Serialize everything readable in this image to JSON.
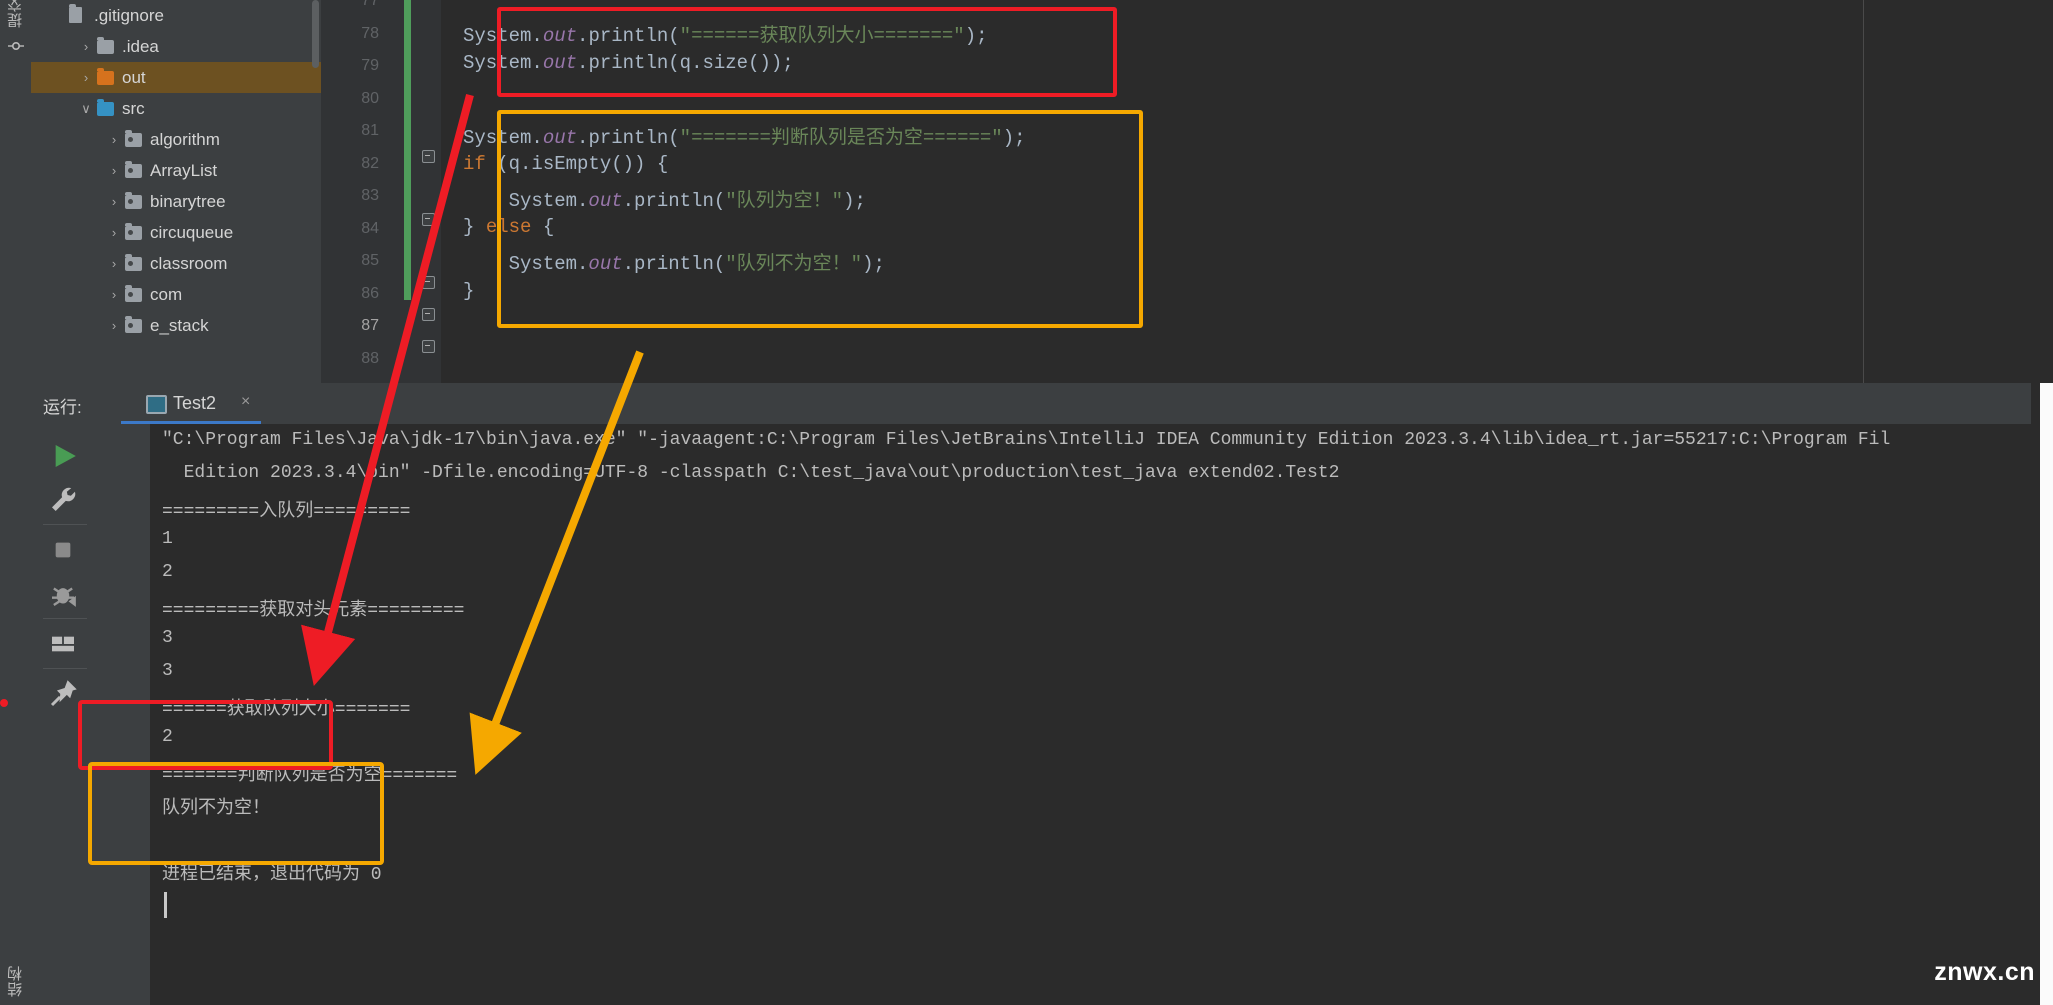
{
  "app": {
    "watermark": "znwx.cn"
  },
  "left_strip": {
    "top_tab": "提交",
    "bottom_tab": "结构",
    "icons": [
      "commit-icon",
      "structure-icon"
    ]
  },
  "project_tree": {
    "items": [
      {
        "label": ".gitignore",
        "icon": "gitignore-file-icon",
        "indent": 0,
        "twisty": "",
        "selected": false,
        "kind": "file"
      },
      {
        "label": ".idea",
        "icon": "folder-grey-icon",
        "indent": 1,
        "twisty": "›",
        "selected": false,
        "kind": "folder"
      },
      {
        "label": "out",
        "icon": "folder-orange-icon",
        "indent": 1,
        "twisty": "›",
        "selected": true,
        "kind": "folder"
      },
      {
        "label": "src",
        "icon": "folder-blue-icon",
        "indent": 1,
        "twisty": "∨",
        "selected": false,
        "kind": "source-folder"
      },
      {
        "label": "algorithm",
        "icon": "package-icon",
        "indent": 2,
        "twisty": "›",
        "selected": false,
        "kind": "package"
      },
      {
        "label": "ArrayList",
        "icon": "package-icon",
        "indent": 2,
        "twisty": "›",
        "selected": false,
        "kind": "package"
      },
      {
        "label": "binarytree",
        "icon": "package-icon",
        "indent": 2,
        "twisty": "›",
        "selected": false,
        "kind": "package"
      },
      {
        "label": "circuqueue",
        "icon": "package-icon",
        "indent": 2,
        "twisty": "›",
        "selected": false,
        "kind": "package"
      },
      {
        "label": "classroom",
        "icon": "package-icon",
        "indent": 2,
        "twisty": "›",
        "selected": false,
        "kind": "package"
      },
      {
        "label": "com",
        "icon": "package-icon",
        "indent": 2,
        "twisty": "›",
        "selected": false,
        "kind": "package"
      },
      {
        "label": "e_stack",
        "icon": "package-icon",
        "indent": 2,
        "twisty": "›",
        "selected": false,
        "kind": "package"
      }
    ]
  },
  "editor": {
    "line_numbers": [
      "77",
      "78",
      "79",
      "80",
      "81",
      "82",
      "83",
      "84",
      "85",
      "86",
      "87",
      "88"
    ],
    "current_line": "87",
    "lines": [
      {
        "num": "78",
        "segments": [
          {
            "t": "System.",
            "c": "plain"
          },
          {
            "t": "out",
            "c": "field"
          },
          {
            "t": ".println(",
            "c": "plain"
          },
          {
            "t": "\"======获取队列大小=======\"",
            "c": "str"
          },
          {
            "t": ");",
            "c": "plain"
          }
        ]
      },
      {
        "num": "79",
        "segments": [
          {
            "t": "System.",
            "c": "plain"
          },
          {
            "t": "out",
            "c": "field"
          },
          {
            "t": ".println(q.size());",
            "c": "plain"
          }
        ]
      },
      {
        "num": "81",
        "segments": [
          {
            "t": "System.",
            "c": "plain"
          },
          {
            "t": "out",
            "c": "field"
          },
          {
            "t": ".println(",
            "c": "plain"
          },
          {
            "t": "\"=======判断队列是否为空======\"",
            "c": "str"
          },
          {
            "t": ");",
            "c": "plain"
          }
        ]
      },
      {
        "num": "82",
        "segments": [
          {
            "t": "if",
            "c": "kw"
          },
          {
            "t": " (q.isEmpty()) {",
            "c": "plain"
          }
        ]
      },
      {
        "num": "83",
        "segments": [
          {
            "t": "    System.",
            "c": "plain"
          },
          {
            "t": "out",
            "c": "field"
          },
          {
            "t": ".println(",
            "c": "plain"
          },
          {
            "t": "\"队列为空！\"",
            "c": "str"
          },
          {
            "t": ");",
            "c": "plain"
          }
        ]
      },
      {
        "num": "84",
        "segments": [
          {
            "t": "} ",
            "c": "plain"
          },
          {
            "t": "else",
            "c": "kw"
          },
          {
            "t": " {",
            "c": "plain"
          }
        ]
      },
      {
        "num": "85",
        "segments": [
          {
            "t": "    System.",
            "c": "plain"
          },
          {
            "t": "out",
            "c": "field"
          },
          {
            "t": ".println(",
            "c": "plain"
          },
          {
            "t": "\"队列不为空！\"",
            "c": "str"
          },
          {
            "t": ");",
            "c": "plain"
          }
        ]
      },
      {
        "num": "86",
        "segments": [
          {
            "t": "}",
            "c": "plain"
          }
        ]
      },
      {
        "num": "87",
        "segments": [
          {
            "t": "}",
            "c": "plain"
          }
        ]
      },
      {
        "num": "88",
        "segments": [
          {
            "t": "}",
            "c": "plain"
          }
        ]
      }
    ]
  },
  "run_window": {
    "label": "运行:",
    "tab_name": "Test2",
    "close_glyph": "×",
    "toolbar_left": [
      {
        "name": "run-button",
        "glyph": "▶",
        "color": "#499c54"
      },
      {
        "name": "settings-wrench-button",
        "glyph": "wrench",
        "color": "#bdbdbd"
      },
      {
        "name": "stop-button",
        "glyph": "■",
        "color": "#888888"
      },
      {
        "name": "rerun-failed-tests-button",
        "glyph": "bug",
        "color": "#9a9a9a"
      },
      {
        "name": "layout-button",
        "glyph": "layout",
        "color": "#bdbdbd"
      },
      {
        "name": "pin-tab-button",
        "glyph": "pin",
        "color": "#bdbdbd"
      }
    ],
    "toolbar_right": [
      {
        "name": "up-arrow-button",
        "glyph": "↑"
      },
      {
        "name": "down-arrow-button",
        "glyph": "↓"
      },
      {
        "name": "soft-wrap-button",
        "glyph": "wrap",
        "active": true
      },
      {
        "name": "scroll-to-end-button",
        "glyph": "scroll-end",
        "active": true
      },
      {
        "name": "print-button",
        "glyph": "printer"
      },
      {
        "name": "clear-all-button",
        "glyph": "trash"
      }
    ],
    "console_lines": [
      "\"C:\\Program Files\\Java\\jdk-17\\bin\\java.exe\" \"-javaagent:C:\\Program Files\\JetBrains\\IntelliJ IDEA Community Edition 2023.3.4\\lib\\idea_rt.jar=55217:C:\\Program Fil",
      "  Edition 2023.3.4\\bin\" -Dfile.encoding=UTF-8 -classpath C:\\test_java\\out\\production\\test_java extend02.Test2",
      "=========入队列=========",
      "1",
      "2",
      "=========获取对头元素=========",
      "3",
      "3",
      "======获取队列大小=======",
      "2",
      "=======判断队列是否为空=======",
      "队列不为空！",
      "",
      "进程已结束，退出代码为 0"
    ]
  },
  "annotations": {
    "colors": {
      "red": "#ee1c25",
      "orange": "#f5a800"
    },
    "boxes": [
      {
        "name": "code-red-box",
        "color": "red"
      },
      {
        "name": "code-orange-box",
        "color": "orange"
      },
      {
        "name": "console-red-box",
        "color": "red"
      },
      {
        "name": "console-orange-box",
        "color": "orange"
      }
    ],
    "arrows": [
      {
        "name": "red-arrow",
        "color": "red",
        "from": "code-red-box",
        "to": "console-red-box"
      },
      {
        "name": "orange-arrow",
        "color": "orange",
        "from": "code-orange-box",
        "to": "console-orange-box"
      }
    ]
  }
}
